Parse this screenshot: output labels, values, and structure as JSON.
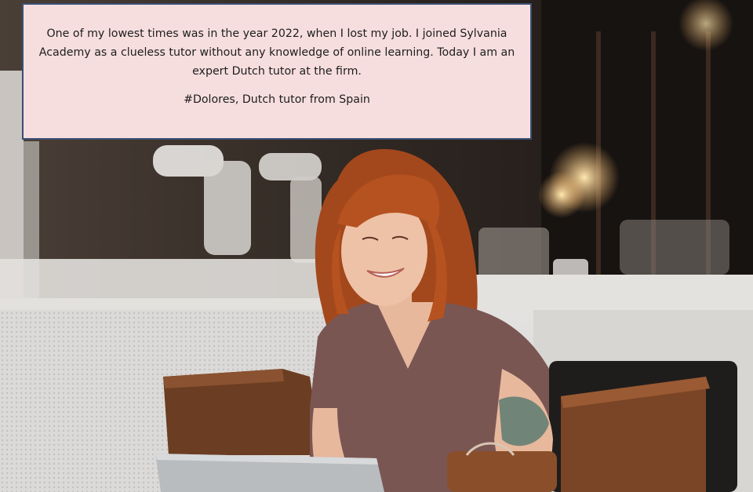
{
  "quote": {
    "text": "One of my lowest times was in the year 2022, when I lost my job. I joined Sylvania Academy as a clueless tutor without any knowledge of online learning. Today I am an expert Dutch tutor at the firm.",
    "signature": "#Dolores, Dutch tutor from Spain"
  },
  "scene": {
    "subject": "smiling woman with wavy red hair using a laptop at a cafe table",
    "colors": {
      "quote_background": "#f7dede",
      "quote_border": "#3b4f73",
      "hair": "#b5521f",
      "shirt": "#7a5653",
      "chair_wood": "#6b3d22"
    }
  }
}
